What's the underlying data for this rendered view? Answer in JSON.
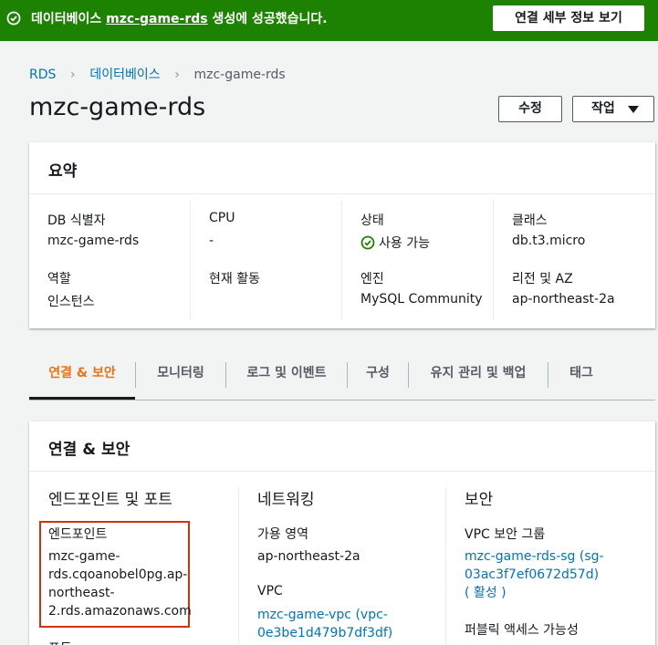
{
  "banner": {
    "message_prefix": "데이터베이스",
    "db_link": "mzc-game-rds",
    "message_suffix": "생성에 성공했습니다.",
    "details_button": "연결 세부 정보 보기",
    "color": "#1d8102"
  },
  "breadcrumb": [
    "RDS",
    "데이터베이스",
    "mzc-game-rds"
  ],
  "page_title": "mzc-game-rds",
  "buttons": {
    "edit": "수정",
    "actions": "작업"
  },
  "summary": {
    "title": "요약",
    "fields": [
      {
        "label": "DB 식별자",
        "value": "mzc-game-rds"
      },
      {
        "label": "CPU",
        "value": "-"
      },
      {
        "label": "상태",
        "value": "사용 가능"
      },
      {
        "label": "클래스",
        "value": "db.t3.micro"
      },
      {
        "label": "역할",
        "value": "인스턴스"
      },
      {
        "label": "현재 활동",
        "value": ""
      },
      {
        "label": "엔진",
        "value": "MySQL Community"
      },
      {
        "label": "리전 및 AZ",
        "value": "ap-northeast-2a"
      }
    ]
  },
  "tabs": [
    "연결 & 보안",
    "모니터링",
    "로그 및 이벤트",
    "구성",
    "유지 관리 및 백업",
    "태그"
  ],
  "active_tab_color": "#ec7211",
  "connectivity": {
    "title": "연결 & 보안",
    "endpoint_section": {
      "title": "엔드포인트 및 포트",
      "endpoint_label": "엔드포인트",
      "endpoint_lines": [
        "mzc-game-",
        "rds.cqoanobel0pg.ap-",
        "northeast-",
        "2.rds.amazonaws.com"
      ],
      "port_label": "포트"
    },
    "networking_section": {
      "title": "네트워킹",
      "az_label": "가용 영역",
      "az_value": "ap-northeast-2a",
      "vpc_label": "VPC",
      "vpc_lines": [
        "mzc-game-vpc (vpc-",
        "0e3be1d479b7df3df)"
      ]
    },
    "security_section": {
      "title": "보안",
      "sg_label": "VPC 보안 그룹",
      "sg_lines": [
        "mzc-game-rds-sg (sg-",
        "03ac3f7ef0672d57d)",
        "( 활성 )"
      ],
      "public_label": "퍼블릭 액세스 가능성"
    }
  }
}
